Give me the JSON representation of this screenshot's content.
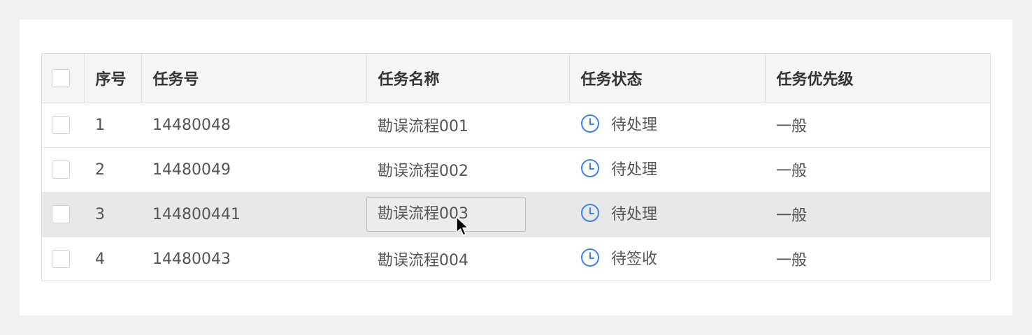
{
  "table": {
    "headers": {
      "index": "序号",
      "task_no": "任务号",
      "task_name": "任务名称",
      "task_status": "任务状态",
      "task_priority": "任务优先级"
    },
    "rows": [
      {
        "index": "1",
        "task_no": "14480048",
        "task_name": "勘误流程001",
        "status": "待处理",
        "priority": "一般"
      },
      {
        "index": "2",
        "task_no": "14480049",
        "task_name": "勘误流程002",
        "status": "待处理",
        "priority": "一般"
      },
      {
        "index": "3",
        "task_no": "144800441",
        "task_name": "勘误流程003",
        "status": "待处理",
        "priority": "一般"
      },
      {
        "index": "4",
        "task_no": "14480043",
        "task_name": "勘误流程004",
        "status": "待签收",
        "priority": "一般"
      }
    ],
    "hovered_row": 3
  },
  "colors": {
    "status_icon": "#3b82f6",
    "header_bg": "#f5f5f5",
    "hover_row_bg": "#e8e8e8"
  },
  "icons": {
    "status": "clock-icon",
    "pointer": "mouse-pointer-icon"
  }
}
